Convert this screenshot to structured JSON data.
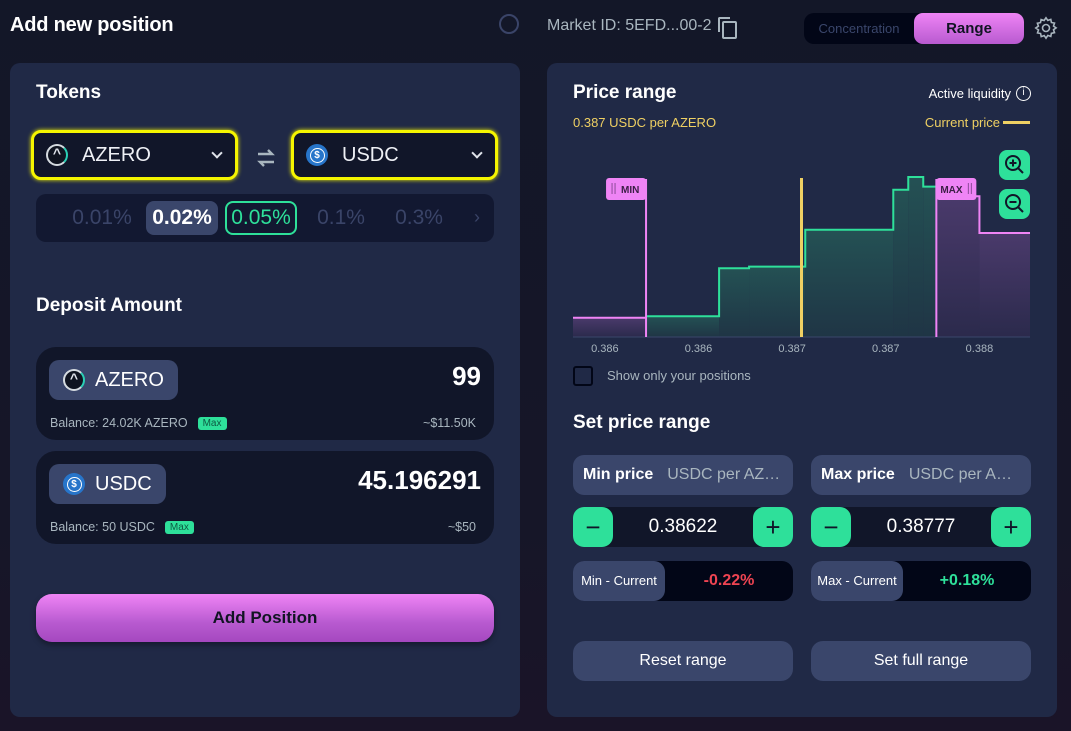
{
  "header": {
    "title": "Add new position",
    "market_id": "Market ID: 5EFD...00-2",
    "modes": [
      "Concentration",
      "Range"
    ],
    "active_mode": "Range"
  },
  "tokens": {
    "title": "Tokens",
    "token_a": "AZERO",
    "token_b": "USDC",
    "fees": [
      "0.01%",
      "0.02%",
      "0.05%",
      "0.1%",
      "0.3%"
    ],
    "selected_fee": "0.02%",
    "best_fee": "0.05%"
  },
  "deposit": {
    "title": "Deposit Amount",
    "items": [
      {
        "token": "AZERO",
        "amount": "99",
        "balance": "Balance: 24.02K AZERO",
        "max_label": "Max",
        "usd": "~$11.50K"
      },
      {
        "token": "USDC",
        "amount": "45.196291",
        "balance": "Balance: 50 USDC",
        "max_label": "Max",
        "usd": "~$50"
      }
    ],
    "add_button": "Add Position"
  },
  "price_range": {
    "title": "Price range",
    "current_price_text": "0.387 USDC per AZERO",
    "active_liquidity_label": "Active liquidity",
    "current_price_label": "Current price",
    "show_only_label": "Show only your positions",
    "show_only_checked": false
  },
  "set_range": {
    "title": "Set price range",
    "min_label": "Min price",
    "max_label": "Max price",
    "min_unit": "USDC per AZERO",
    "max_unit": "USDC per AZERO",
    "min_value": "0.38622",
    "max_value": "0.38777",
    "min_current_label": "Min - Current",
    "max_current_label": "Max - Current",
    "min_current_value": "-0.22%",
    "max_current_value": "+0.18%",
    "reset_label": "Reset range",
    "full_label": "Set full range"
  },
  "colors": {
    "accent_green": "#2ee09a",
    "accent_pink": "#ef84f5",
    "current_price": "#efd063",
    "negative": "#ef4452",
    "positive": "#2ee09a"
  },
  "chart_data": {
    "type": "area",
    "title": "Price range",
    "xlabel": "",
    "ylabel": "",
    "tick_labels": [
      "0.386",
      "0.386",
      "0.387",
      "0.387",
      "0.388"
    ],
    "tick_values": [
      0.386,
      0.3865,
      0.387,
      0.3875,
      0.388
    ],
    "xlim": [
      0.38583,
      0.38827
    ],
    "ylim": [
      0,
      1
    ],
    "current_price": 0.38705,
    "range_min": 0.38622,
    "range_max": 0.38777,
    "min_label": "MIN",
    "max_label": "MAX",
    "liquidity_steps": [
      {
        "from": 0.38583,
        "to": 0.38622,
        "value": 0.12
      },
      {
        "from": 0.38622,
        "to": 0.38661,
        "value": 0.13
      },
      {
        "from": 0.38661,
        "to": 0.38677,
        "value": 0.43
      },
      {
        "from": 0.38677,
        "to": 0.38707,
        "value": 0.44
      },
      {
        "from": 0.38707,
        "to": 0.38754,
        "value": 0.67
      },
      {
        "from": 0.38754,
        "to": 0.38762,
        "value": 0.92
      },
      {
        "from": 0.38762,
        "to": 0.3877,
        "value": 1.0
      },
      {
        "from": 0.3877,
        "to": 0.38777,
        "value": 0.94
      },
      {
        "from": 0.38777,
        "to": 0.388,
        "value": 0.88
      },
      {
        "from": 0.388,
        "to": 0.38827,
        "value": 0.65
      }
    ]
  }
}
